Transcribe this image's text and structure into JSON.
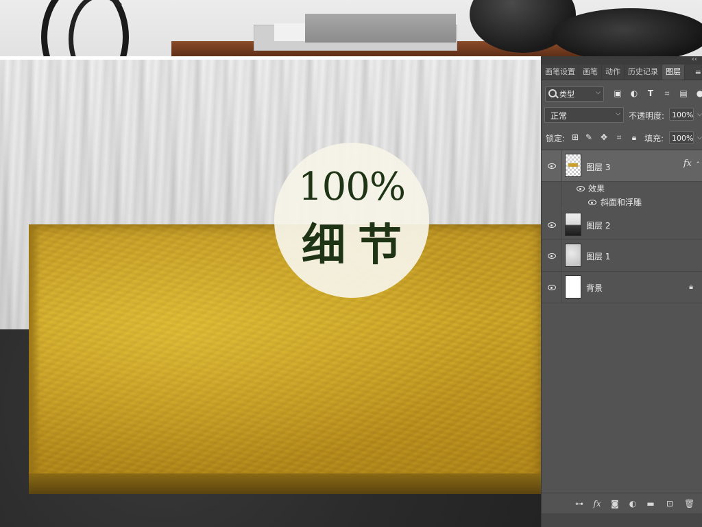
{
  "canvas": {
    "badge_percent": "100%",
    "badge_word": "细节"
  },
  "layers_panel": {
    "tabs": [
      {
        "label": "画笔设置",
        "active": false
      },
      {
        "label": "画笔",
        "active": false
      },
      {
        "label": "动作",
        "active": false
      },
      {
        "label": "历史记录",
        "active": false
      },
      {
        "label": "图层",
        "active": true
      }
    ],
    "filter_kind": "类型",
    "blend_mode": "正常",
    "opacity_label": "不透明度:",
    "opacity_value": "100%",
    "lock_label": "锁定:",
    "fill_label": "填充:",
    "fill_value": "100%",
    "layers": [
      {
        "name": "图层 3",
        "selected": true,
        "has_fx": true,
        "fx_label": "fx"
      },
      {
        "name": "效果"
      },
      {
        "name": "斜面和浮雕"
      },
      {
        "name": "图层 2",
        "selected": false
      },
      {
        "name": "图层 1",
        "selected": false
      },
      {
        "name": "背景",
        "locked": true
      }
    ],
    "icons": {
      "filter_row": [
        "image-filter-icon",
        "adjustment-filter-icon",
        "type-filter-icon",
        "shape-filter-icon",
        "smart-object-filter-icon"
      ],
      "lock_row": [
        "lock-transparent-icon",
        "lock-paint-icon",
        "lock-move-icon",
        "artboard-icon",
        "lock-all-icon"
      ],
      "footer": [
        "link-layers-icon",
        "fx-icon",
        "add-mask-icon",
        "adjustment-layer-icon",
        "new-group-icon",
        "new-layer-icon",
        "delete-layer-icon"
      ]
    }
  }
}
